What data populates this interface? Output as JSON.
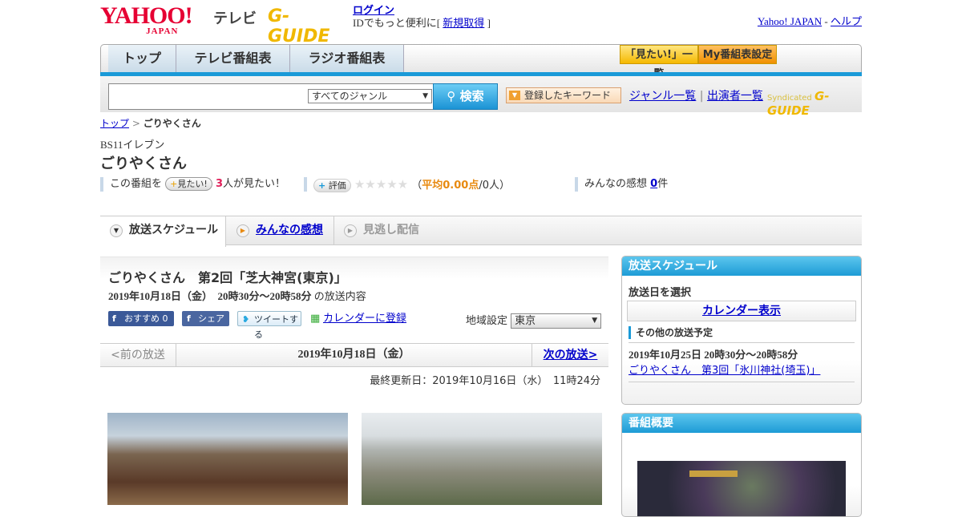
{
  "header": {
    "logo_main": "YAHOO!",
    "logo_sub": "JAPAN",
    "service": "テレビ",
    "gguide_logo": "G-GUIDE",
    "login": "ログイン",
    "id_prefix": "IDでもっと便利に[ ",
    "register": "新規取得",
    "id_suffix": " ]",
    "yahoo_japan": "Yahoo! JAPAN",
    "sep": " - ",
    "help": "ヘルプ"
  },
  "nav": {
    "tabs": [
      "トップ",
      "テレビ番組表",
      "ラジオ番組表"
    ],
    "mitai_list": "「見たい!」一覧",
    "my_settings": "My番組表設定"
  },
  "search": {
    "input_value": "",
    "genre": "すべてのジャンル",
    "button": "検索",
    "keyword": "登録したキーワード",
    "genre_list": "ジャンル一覧",
    "cast_list": "出演者一覧",
    "divider": "|",
    "syndicated": "Syndicated",
    "syndicated_logo": "G-GUIDE"
  },
  "breadcrumb": {
    "top": "トップ",
    "sep": " > ",
    "current": "ごりやくさん"
  },
  "program": {
    "channel": "BS11イレブン",
    "title": "ごりやくさん",
    "want_prefix": "この番組を",
    "want_button": "見たい!",
    "want_count": "3",
    "want_suffix": "人が見たい！",
    "rate_button": "評価",
    "stars": 0,
    "avg_open": "（",
    "avg_label": "平均0.00点",
    "avg_rest": "/0人）",
    "impressions_label": "みんなの感想 ",
    "impressions_count": "0",
    "impressions_suffix": "件"
  },
  "tabs": [
    {
      "label": "放送スケジュール"
    },
    {
      "label": "みんなの感想"
    },
    {
      "label": "見逃し配信"
    }
  ],
  "episode": {
    "title": "ごりやくさん　第2回「芝大神宮(東京)」",
    "time": "2019年10月18日（金）　20時30分～20時58分",
    "time_suffix": " の放送内容",
    "fb_recommend": "おすすめ 0",
    "fb_share": "シェア",
    "tweet": "ツイートする",
    "calendar": "カレンダーに登録",
    "region_label": "地域設定 ",
    "region": "東京"
  },
  "pager": {
    "prev": "<前の放送",
    "date": "2019年10月18日（金）",
    "next": "次の放送>"
  },
  "updated": "最終更新日：2019年10月16日（水）　11時24分",
  "sidebar": {
    "schedule_title": "放送スケジュール",
    "select_date": "放送日を選択",
    "calendar": "カレンダー表示",
    "other": "その他の放送予定",
    "next_time": "2019年10月25日  20時30分～20時58分",
    "next_title": "ごりやくさん　第3回「氷川神社(埼玉)」",
    "overview_title": "番組概要"
  }
}
